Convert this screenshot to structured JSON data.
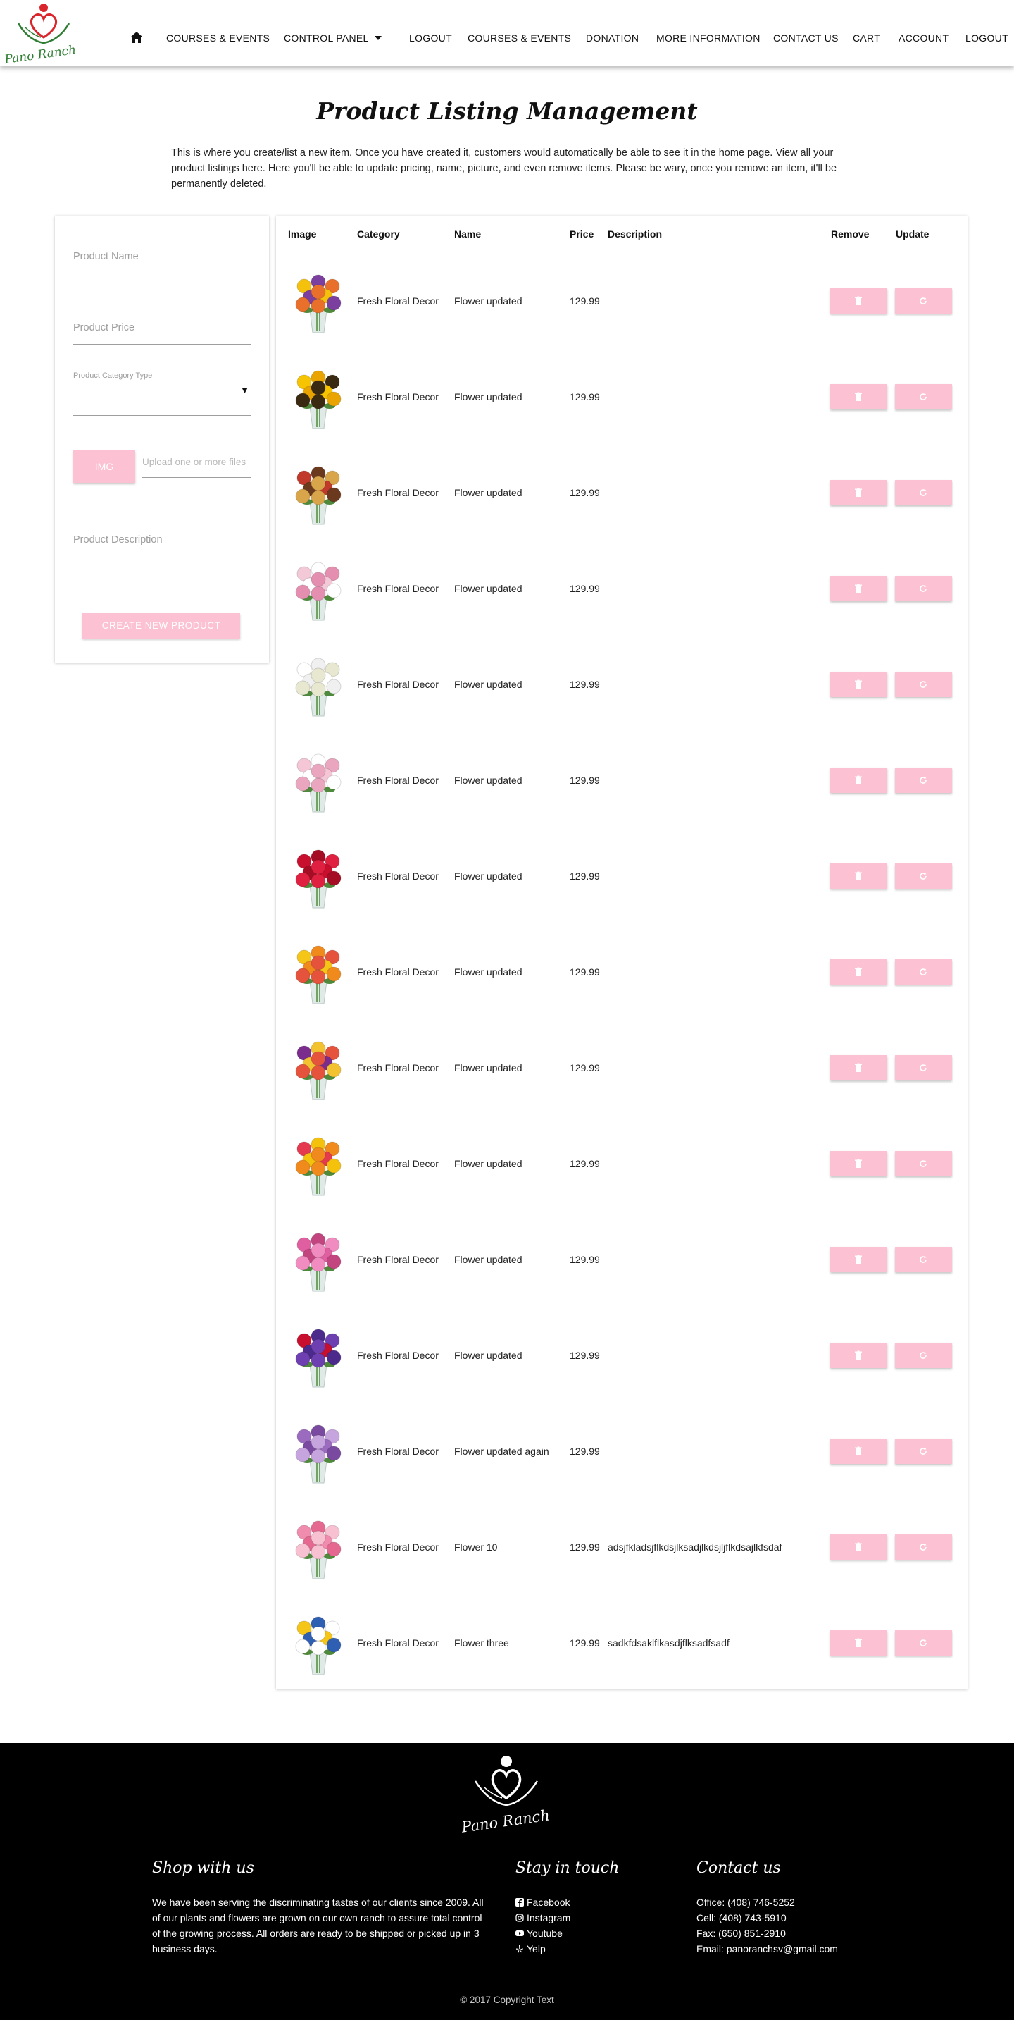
{
  "brand": {
    "name": "Pano Ranch",
    "accent": "#fcc1d3",
    "logo_red": "#d9252b",
    "logo_green": "#2e7d32"
  },
  "nav": {
    "items": [
      "COURSES & EVENTS",
      "CONTROL PANEL",
      "LOGOUT",
      "COURSES & EVENTS",
      "DONATION",
      "MORE INFORMATION",
      "CONTACT US",
      "CART",
      "ACCOUNT",
      "LOGOUT"
    ]
  },
  "page": {
    "title": "Product Listing Management",
    "intro": "This is where you create/list a new item. Once you have created it, customers would automatically be able to see it in the home page. View all your product listings here. Here you'll be able to update pricing, name, picture, and even remove items. Please be wary, once you remove an item, it'll be permanently deleted."
  },
  "form": {
    "product_name_placeholder": "Product Name",
    "product_price_placeholder": "Product Price",
    "category_label": "Product Category Type",
    "img_button": "IMG",
    "upload_placeholder": "Upload one or more files",
    "description_placeholder": "Product Description",
    "create_button": "CREATE NEW PRODUCT"
  },
  "table": {
    "headers": [
      "Image",
      "Category",
      "Name",
      "Price",
      "Description",
      "Remove",
      "Update"
    ],
    "rows": [
      {
        "category": "Fresh Floral Decor",
        "name": "Flower updated",
        "price": "129.99",
        "description": "",
        "palette": [
          "#f4c20d",
          "#7b3fa0",
          "#e8702a"
        ]
      },
      {
        "category": "Fresh Floral Decor",
        "name": "Flower updated",
        "price": "129.99",
        "description": "",
        "palette": [
          "#f6c400",
          "#e9a400",
          "#3b2a12"
        ]
      },
      {
        "category": "Fresh Floral Decor",
        "name": "Flower updated",
        "price": "129.99",
        "description": "",
        "palette": [
          "#c0392b",
          "#6b3a1e",
          "#d9a54a"
        ]
      },
      {
        "category": "Fresh Floral Decor",
        "name": "Flower updated",
        "price": "129.99",
        "description": "",
        "palette": [
          "#f3c9d8",
          "#ffffff",
          "#e58fb0"
        ]
      },
      {
        "category": "Fresh Floral Decor",
        "name": "Flower updated",
        "price": "129.99",
        "description": "",
        "palette": [
          "#ffffff",
          "#f0f0f0",
          "#e8e8d0"
        ]
      },
      {
        "category": "Fresh Floral Decor",
        "name": "Flower updated",
        "price": "129.99",
        "description": "",
        "palette": [
          "#f4c6d6",
          "#ffffff",
          "#e9a6be"
        ]
      },
      {
        "category": "Fresh Floral Decor",
        "name": "Flower updated",
        "price": "129.99",
        "description": "",
        "palette": [
          "#c8102e",
          "#a50d24",
          "#e02040"
        ]
      },
      {
        "category": "Fresh Floral Decor",
        "name": "Flower updated",
        "price": "129.99",
        "description": "",
        "palette": [
          "#f5c518",
          "#f08a1c",
          "#e5533d"
        ]
      },
      {
        "category": "Fresh Floral Decor",
        "name": "Flower updated",
        "price": "129.99",
        "description": "",
        "palette": [
          "#7b2d8e",
          "#f2c230",
          "#e5533d"
        ]
      },
      {
        "category": "Fresh Floral Decor",
        "name": "Flower updated",
        "price": "129.99",
        "description": "",
        "palette": [
          "#e53950",
          "#f4c20d",
          "#f08a1c"
        ]
      },
      {
        "category": "Fresh Floral Decor",
        "name": "Flower updated",
        "price": "129.99",
        "description": "",
        "palette": [
          "#e05fa0",
          "#c2457f",
          "#f08cc0"
        ]
      },
      {
        "category": "Fresh Floral Decor",
        "name": "Flower updated",
        "price": "129.99",
        "description": "",
        "palette": [
          "#c8102e",
          "#4b2a8c",
          "#6d3fb0"
        ]
      },
      {
        "category": "Fresh Floral Decor",
        "name": "Flower updated again",
        "price": "129.99",
        "description": "",
        "palette": [
          "#9b6bbf",
          "#7a4aa0",
          "#c6a4de"
        ]
      },
      {
        "category": "Fresh Floral Decor",
        "name": "Flower 10",
        "price": "129.99",
        "description": "adsjfkladsjflkdsjlksadjlkdsjljflkdsajlkfsdaf",
        "palette": [
          "#f08cae",
          "#e46890",
          "#f7c1d2"
        ]
      },
      {
        "category": "Fresh Floral Decor",
        "name": "Flower three",
        "price": "129.99",
        "description": "sadkfdsaklflkasdjflksadfsadf",
        "palette": [
          "#f5c518",
          "#2f5fb3",
          "#ffffff"
        ]
      }
    ]
  },
  "footer": {
    "shop_title": "Shop with us",
    "shop_text": "We have been serving the discriminating tastes of our clients since 2009. All of our plants and flowers are grown on our own ranch to assure total control of the growing process. All orders are ready to be shipped or picked up in 3 business days.",
    "stay_title": "Stay in touch",
    "social": [
      "Facebook",
      "Instagram",
      "Youtube",
      "Yelp"
    ],
    "contact_title": "Contact us",
    "contact": [
      "Office: (408) 746-5252",
      "Cell: (408) 743-5910",
      "Fax: (650) 851-2910",
      "Email: panoranchsv@gmail.com"
    ],
    "copyright": "© 2017 Copyright Text"
  }
}
